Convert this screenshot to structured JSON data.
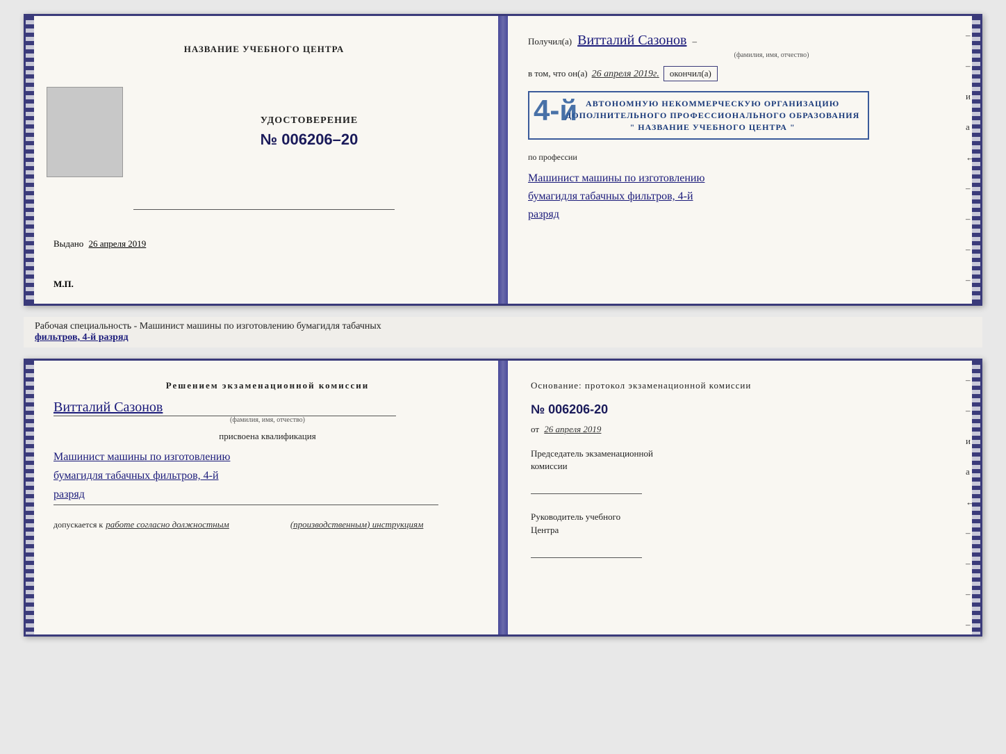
{
  "top_doc": {
    "left": {
      "header": "НАЗВАНИЕ УЧЕБНОГО ЦЕНТРА",
      "udostoverenie_title": "УДОСТОВЕРЕНИЕ",
      "udostoverenie_number": "№ 006206–20",
      "vydano": "Выдано",
      "vydano_date": "26 апреля 2019",
      "mp": "М.П."
    },
    "right": {
      "poluchil": "Получил(а)",
      "name_handwritten": "Витталий  Сазонов",
      "fio_label": "(фамилия, имя, отчество)",
      "dash": "–",
      "vtom": "в том, что он(а)",
      "date_handwritten": "26 апреля 2019г.",
      "okonchil": "окончил(а)",
      "stamp_number": "4-й",
      "stamp_line1": "АВТОНОМНУЮ НЕКОММЕРЧЕСКУЮ ОРГАНИЗАЦИЮ",
      "stamp_line2": "ДОПОЛНИТЕЛЬНОГО ПРОФЕССИОНАЛЬНОГО ОБРАЗОВАНИЯ",
      "stamp_line3": "\" НАЗВАНИЕ УЧЕБНОГО ЦЕНТРА \"",
      "i_label": "и",
      "a_label": "а",
      "arrow_label": "←",
      "profession_label": "по профессии",
      "profession_handwritten_1": "Машинист машины по изготовлению",
      "profession_handwritten_2": "бумагидля табачных фильтров, 4-й",
      "profession_handwritten_3": "разряд"
    }
  },
  "middle": {
    "line1": "Рабочая специальность - Машинист машины по изготовлению бумагидля табачных",
    "line2": "фильтров, 4-й разряд"
  },
  "bottom_doc": {
    "left": {
      "resheniem": "Решением  экзаменационной  комиссии",
      "name_handwritten": "Витталий  Сазонов",
      "fio_label": "(фамилия, имя, отчество)",
      "prisvoena": "присвоена квалификация",
      "prof_1": "Машинист машины по изготовлению",
      "prof_2": "бумагидля табачных фильтров, 4-й",
      "prof_3": "разряд",
      "dopuskaetsya": "допускается к",
      "work_label": "работе согласно должностным",
      "work_label2": "(производственным) инструкциям"
    },
    "right": {
      "osnovanie": "Основание: протокол экзаменационной  комиссии",
      "number_label": "№  006206-20",
      "ot_label": "от",
      "date_label": "26 апреля 2019",
      "chairman_label": "Председатель экзаменационной",
      "chairman_label2": "комиссии",
      "rukovoditel_label": "Руководитель учебного",
      "rukovoditel_label2": "Центра",
      "i_label": "и",
      "a_label": "а",
      "arrow_label": "←"
    }
  }
}
